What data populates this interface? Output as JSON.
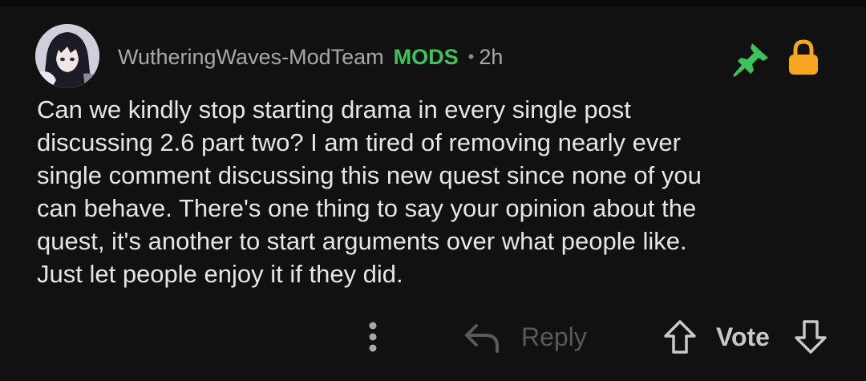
{
  "comment": {
    "username": "WutheringWaves-ModTeam",
    "badge": "MODS",
    "separator": "•",
    "time": "2h",
    "body_lines": [
      "Can we kindly stop starting drama in every single post",
      "discussing 2.6 part two? I am tired of removing nearly ever",
      "single comment discussing this new quest since none of you",
      "can behave. There's one thing to say your opinion about the",
      "quest, it's another to start arguments over what people like.",
      "Just let people enjoy it if they did."
    ]
  },
  "icons": {
    "avatar": "avatar-image",
    "pin": "pin-icon",
    "lock": "lock-icon",
    "more": "more-vertical-icon",
    "reply": "reply-arrow-icon",
    "upvote": "upvote-arrow-icon",
    "downvote": "downvote-arrow-icon"
  },
  "actions": {
    "reply_label": "Reply",
    "vote_label": "Vote"
  },
  "colors": {
    "background": "#111111",
    "mods_badge": "#3ec35a",
    "pin": "#3ec35a",
    "lock": "#f5a623",
    "username": "#a8a8a8"
  }
}
